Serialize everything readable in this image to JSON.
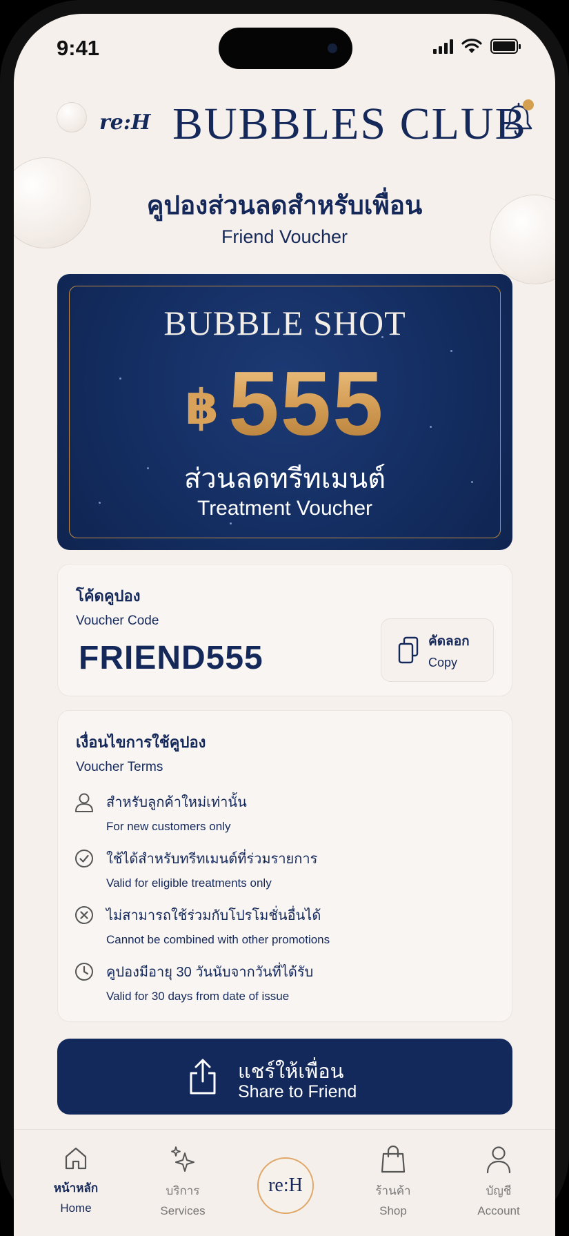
{
  "status_bar": {
    "time": "9:41"
  },
  "header": {
    "logo": "re:H",
    "club_title": "BUBBLES CLUB",
    "notification_icon": "bell-icon",
    "notification_dot_color": "#d4a050"
  },
  "page": {
    "title_th": "คูปองส่วนลดสำหรับเพื่อน",
    "title_en": "Friend Voucher"
  },
  "voucher": {
    "product_name": "BUBBLE SHOT",
    "currency": "฿",
    "amount": "555",
    "label_th": "ส่วนลดทรีทเมนต์",
    "label_en": "Treatment Voucher",
    "background_color": "#142e62",
    "accent_color": "#d8a25a"
  },
  "code_section": {
    "label_th": "โค้ดคูปอง",
    "label_en": "Voucher Code",
    "code": "FRIEND555",
    "copy_th": "คัดลอก",
    "copy_en": "Copy"
  },
  "terms": {
    "title_th": "เงื่อนไขการใช้คูปอง",
    "title_en": "Voucher Terms",
    "items": [
      {
        "icon": "user-icon",
        "th": "สำหรับลูกค้าใหม่เท่านั้น",
        "en": "For new customers only"
      },
      {
        "icon": "check-circle-icon",
        "th": "ใช้ได้สำหรับทรีทเมนต์ที่ร่วมรายการ",
        "en": "Valid for eligible treatments only"
      },
      {
        "icon": "x-circle-icon",
        "th": "ไม่สามารถใช้ร่วมกับโปรโมชั่นอื่นได้",
        "en": "Cannot be combined with other promotions"
      },
      {
        "icon": "clock-icon",
        "th": "คูปองมีอายุ 30 วันนับจากวันที่ได้รับ",
        "en": "Valid for 30 days from date of issue"
      }
    ]
  },
  "share_button": {
    "label_th": "แชร์ให้เพื่อน",
    "label_en": "Share to Friend",
    "icon": "share-icon"
  },
  "bottom_nav": {
    "items": [
      {
        "th": "หน้าหลัก",
        "en": "Home",
        "icon": "home-icon",
        "active": true
      },
      {
        "th": "บริการ",
        "en": "Services",
        "icon": "sparkle-icon",
        "active": false
      },
      {
        "th": "ร้านค้า",
        "en": "Shop",
        "icon": "shopping-bag-icon",
        "active": false
      },
      {
        "th": "บัญชี",
        "en": "Account",
        "icon": "person-icon",
        "active": false
      }
    ],
    "center_logo": "re:H"
  }
}
